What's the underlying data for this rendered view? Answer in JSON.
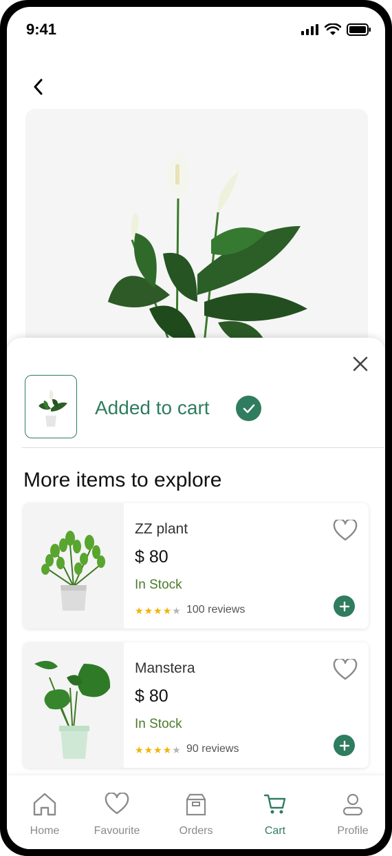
{
  "status": {
    "time": "9:41"
  },
  "sheet": {
    "added_label": "Added to cart",
    "section_title": "More items to explore"
  },
  "products": [
    {
      "name": "ZZ plant",
      "price": "$ 80",
      "stock": "In Stock",
      "rating": 4,
      "reviews": "100 reviews"
    },
    {
      "name": "Manstera",
      "price": "$ 80",
      "stock": "In Stock",
      "rating": 4,
      "reviews": "90 reviews"
    }
  ],
  "tabs": [
    {
      "label": "Home",
      "icon": "home-icon"
    },
    {
      "label": "Favourite",
      "icon": "heart-icon"
    },
    {
      "label": "Orders",
      "icon": "box-icon"
    },
    {
      "label": "Cart",
      "icon": "cart-icon",
      "active": true
    },
    {
      "label": "Profile",
      "icon": "user-icon"
    }
  ],
  "colors": {
    "accent": "#2f7c5f",
    "stock": "#4b7a2c",
    "star": "#f0b400"
  }
}
